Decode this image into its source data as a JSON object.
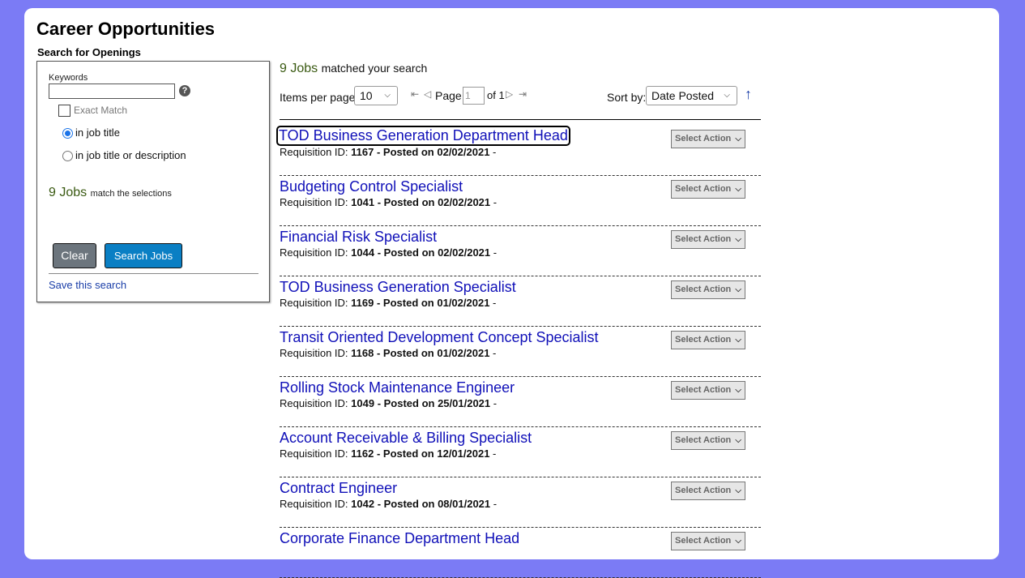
{
  "page": {
    "title": "Career Opportunities",
    "search_heading": "Search for Openings"
  },
  "search_panel": {
    "keywords_label": "Keywords",
    "keywords_value": "",
    "help_symbol": "?",
    "exact_match_label": "Exact Match",
    "exact_match_checked": false,
    "radio_job_title": "in job title",
    "radio_job_title_or_desc": "in job title or description",
    "selected_scope": "in job title",
    "jobs_count": "9 Jobs",
    "jobs_count_suffix": "match the selections",
    "clear_label": "Clear",
    "search_label": "Search Jobs",
    "save_search_label": "Save this search"
  },
  "results": {
    "count": "9 Jobs",
    "count_suffix": "matched your search",
    "items_per_page_label": "Items per page",
    "items_per_page_value": "10",
    "page_label": "Page",
    "page_value": "1",
    "of_label": "of 1",
    "sort_by_label": "Sort by:",
    "sort_by_value": "Date Posted",
    "sort_direction_icon": "arrow-up-icon"
  },
  "jobs": [
    {
      "title": "TOD Business Generation Department Head",
      "req_label": "Requisition ID: ",
      "req_id": "1167",
      "posted": " - Posted on 02/02/2021",
      "tail": " -",
      "action": "Select Action"
    },
    {
      "title": "Budgeting Control Specialist",
      "req_label": "Requisition ID: ",
      "req_id": "1041",
      "posted": " - Posted on 02/02/2021",
      "tail": " -",
      "action": "Select Action"
    },
    {
      "title": "Financial Risk Specialist",
      "req_label": "Requisition ID: ",
      "req_id": "1044",
      "posted": " - Posted on 02/02/2021",
      "tail": " -",
      "action": "Select Action"
    },
    {
      "title": "TOD Business Generation Specialist",
      "req_label": "Requisition ID: ",
      "req_id": "1169",
      "posted": " - Posted on 01/02/2021",
      "tail": " -",
      "action": "Select Action"
    },
    {
      "title": "Transit Oriented Development Concept Specialist",
      "req_label": "Requisition ID: ",
      "req_id": "1168",
      "posted": " - Posted on 01/02/2021",
      "tail": " -",
      "action": "Select Action"
    },
    {
      "title": "Rolling Stock Maintenance Engineer",
      "req_label": "Requisition ID: ",
      "req_id": "1049",
      "posted": " - Posted on 25/01/2021",
      "tail": " -",
      "action": "Select Action"
    },
    {
      "title": "Account Receivable & Billing Specialist",
      "req_label": "Requisition ID: ",
      "req_id": "1162",
      "posted": " - Posted on 12/01/2021",
      "tail": " -",
      "action": "Select Action"
    },
    {
      "title": "Contract Engineer",
      "req_label": "Requisition ID: ",
      "req_id": "1042",
      "posted": " - Posted on 08/01/2021",
      "tail": " -",
      "action": "Select Action"
    },
    {
      "title": "Corporate Finance Department Head",
      "req_label": "",
      "req_id": "",
      "posted": "",
      "tail": "",
      "action": "Select Action"
    }
  ]
}
